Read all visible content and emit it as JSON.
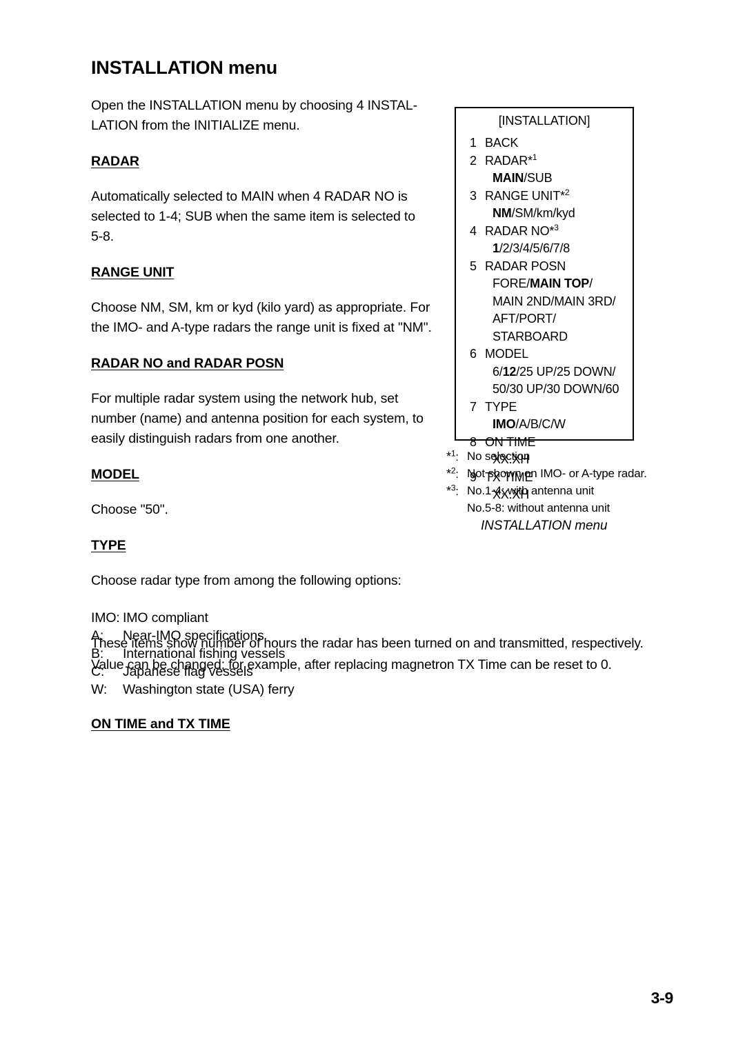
{
  "document": {
    "page_number": "3-9"
  },
  "title": "INSTALLATION menu",
  "intro": "Open the INSTALLATION menu by choosing 4 INSTAL-LATION from the INITIALIZE menu.",
  "sections": [
    {
      "heading": "RADAR",
      "body": "Automatically selected to MAIN when 4 RADAR NO is selected to 1-4; SUB when the same item is selected to 5-8."
    },
    {
      "heading": "RANGE UNIT",
      "body": "Choose NM, SM, km or kyd (kilo yard) as appropriate. For the IMO- and A-type radars the range unit is fixed at \"NM\"."
    },
    {
      "heading": "RADAR NO and RADAR POSN",
      "body": "For multiple radar system using the network hub, set number (name) and antenna position for each system, to easily distinguish radars from one another."
    },
    {
      "heading": "MODEL",
      "body": "Choose \"50\"."
    },
    {
      "heading": "TYPE",
      "body": "Choose radar type from among the following options:"
    },
    {
      "heading": "ON TIME and TX TIME",
      "body": "These items show number of hours the radar has been turned on and transmitted, respectively. Value can be changed; for example, after replacing magnetron TX Time can be reset to 0."
    }
  ],
  "type_options": [
    {
      "key": "IMO:",
      "value": "IMO compliant"
    },
    {
      "key": "A:",
      "value": "Near-IMO specifications"
    },
    {
      "key": "B:",
      "value": "International fishing vessels"
    },
    {
      "key": "C:",
      "value": "Japanese flag vessels"
    },
    {
      "key": "W:",
      "value": "Washington state (USA) ferry"
    }
  ],
  "figure": {
    "menu_title": "[INSTALLATION]",
    "items": [
      {
        "num": "1",
        "label": "BACK",
        "note": "",
        "options": []
      },
      {
        "num": "2",
        "label": "RADAR",
        "note": "*1",
        "options": [
          "MAIN/SUB"
        ]
      },
      {
        "num": "3",
        "label": "RANGE UNIT",
        "note": "*2",
        "options": [
          "NM/SM/km/kyd"
        ]
      },
      {
        "num": "4",
        "label": "RADAR NO",
        "note": "*3",
        "options": [
          "1/2/3/4/5/6/7/8"
        ]
      },
      {
        "num": "5",
        "label": "RADAR POSN",
        "note": "",
        "options": [
          "FORE/MAIN TOP/",
          "MAIN 2ND/MAIN 3RD/",
          "AFT/PORT/",
          "STARBOARD"
        ]
      },
      {
        "num": "6",
        "label": "MODEL",
        "note": "",
        "options": [
          "6/12/25 UP/25 DOWN/",
          "50/30 UP/30 DOWN/60"
        ]
      },
      {
        "num": "7",
        "label": "TYPE",
        "note": "",
        "options": [
          "IMO/A/B/C/W"
        ]
      },
      {
        "num": "8",
        "label": "ON TIME",
        "note": "",
        "options": [
          "XX.XH"
        ]
      },
      {
        "num": "9",
        "label": "TX TIME",
        "note": "",
        "options": [
          "XX.XH"
        ]
      }
    ],
    "footnotes": [
      {
        "marker": "*1",
        "text": "No selection",
        "sub": ""
      },
      {
        "marker": "*2",
        "text": "Not shown on IMO- or A-type radar.",
        "sub": ""
      },
      {
        "marker": "*3",
        "text": "No.1-4: with antenna unit",
        "sub": "No.5-8: without antenna unit"
      }
    ],
    "caption": "INSTALLATION menu"
  }
}
